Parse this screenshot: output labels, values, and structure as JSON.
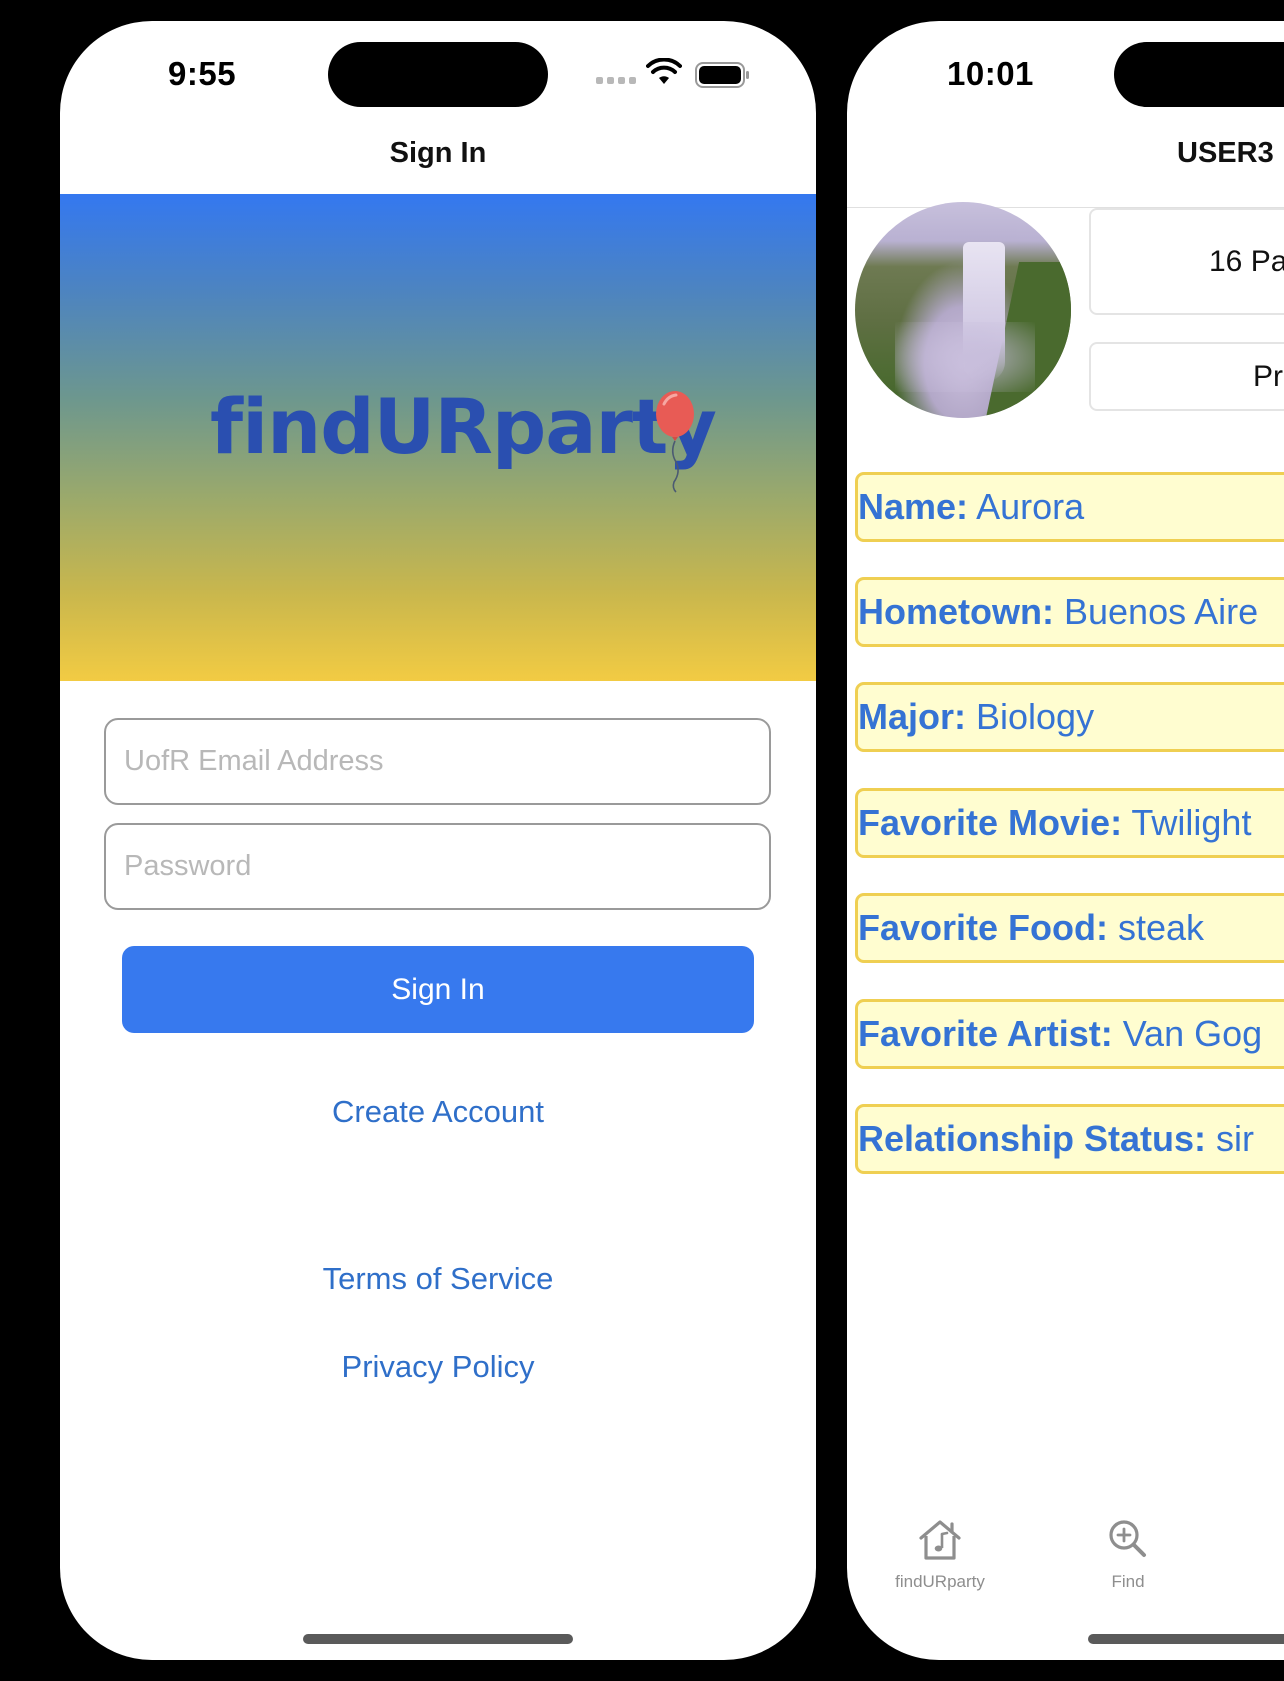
{
  "sign_in_screen": {
    "status_bar": {
      "time": "9:55"
    },
    "nav_title": "Sign In",
    "logo": {
      "text": "findURparty",
      "icon": "balloon-icon"
    },
    "email_field": {
      "value": "",
      "placeholder": "UofR Email Address"
    },
    "password_field": {
      "value": "",
      "placeholder": "Password"
    },
    "sign_in_button": "Sign In",
    "create_account_link": "Create Account",
    "terms_link": "Terms of Service",
    "privacy_link": "Privacy Policy"
  },
  "profile_screen": {
    "status_bar": {
      "time": "10:01"
    },
    "nav_title": "USER3",
    "avatar": {
      "description": "waterfall photo"
    },
    "parties_button": "16 Pa",
    "profile_button": "Pr",
    "attributes": [
      {
        "key": "Name:",
        "value": " Aurora"
      },
      {
        "key": "Hometown:",
        "value": " Buenos Aire"
      },
      {
        "key": "Major:",
        "value": " Biology"
      },
      {
        "key": "Favorite Movie:",
        "value": " Twilight"
      },
      {
        "key": "Favorite Food:",
        "value": " steak"
      },
      {
        "key": "Favorite Artist:",
        "value": " Van Gog"
      },
      {
        "key": "Relationship Status:",
        "value": " sir"
      }
    ],
    "tab_bar": [
      {
        "label": "findURparty",
        "icon": "house-music-icon"
      },
      {
        "label": "Find",
        "icon": "magnifier-plus-icon"
      }
    ]
  },
  "colors": {
    "accent_blue": "#3779ee",
    "link_blue": "#2f6fc9",
    "logo_blue": "#2a4fb0",
    "gradient_top": "#3478f0",
    "gradient_bottom": "#f2cb43",
    "row_fill": "#fffdd0",
    "row_border": "#efcf52",
    "row_text": "#3573d4",
    "balloon_red": "#e85b55"
  }
}
